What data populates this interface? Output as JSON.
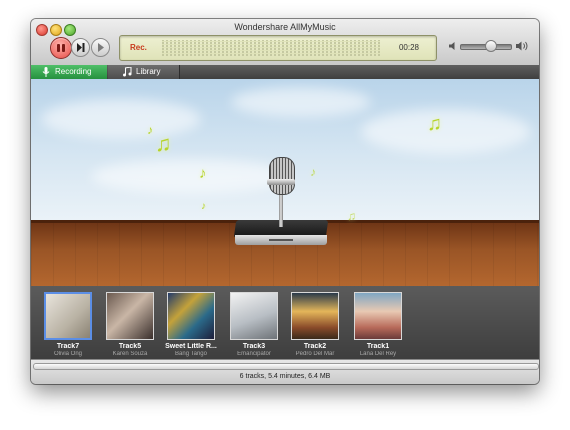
{
  "window": {
    "title": "Wondershare AllMyMusic"
  },
  "toolbar": {
    "rec_indicator": "Rec.",
    "elapsed_time": "00:28",
    "volume_level": 0.6
  },
  "tabs": [
    {
      "label": "Recording",
      "icon": "microphone-icon",
      "active": true
    },
    {
      "label": "Library",
      "icon": "music-note-icon",
      "active": false
    }
  ],
  "tracks": [
    {
      "title": "Track7",
      "artist": "Olivia Ong",
      "selected": true
    },
    {
      "title": "Track5",
      "artist": "Karen Souza",
      "selected": false
    },
    {
      "title": "Sweet Little R...",
      "artist": "Bang Tango",
      "selected": false
    },
    {
      "title": "Track3",
      "artist": "Emancipator",
      "selected": false
    },
    {
      "title": "Track2",
      "artist": "Pedro Del Mar",
      "selected": false
    },
    {
      "title": "Track1",
      "artist": "Lana Del Rey",
      "selected": false
    }
  ],
  "status": {
    "summary": "6 tracks, 5.4 minutes, 6.4 MB"
  },
  "colors": {
    "accent_green": "#2ea148",
    "rec_red": "#e64a43",
    "selection_blue": "#5b8ee6",
    "note_green": "#b7d42a"
  }
}
